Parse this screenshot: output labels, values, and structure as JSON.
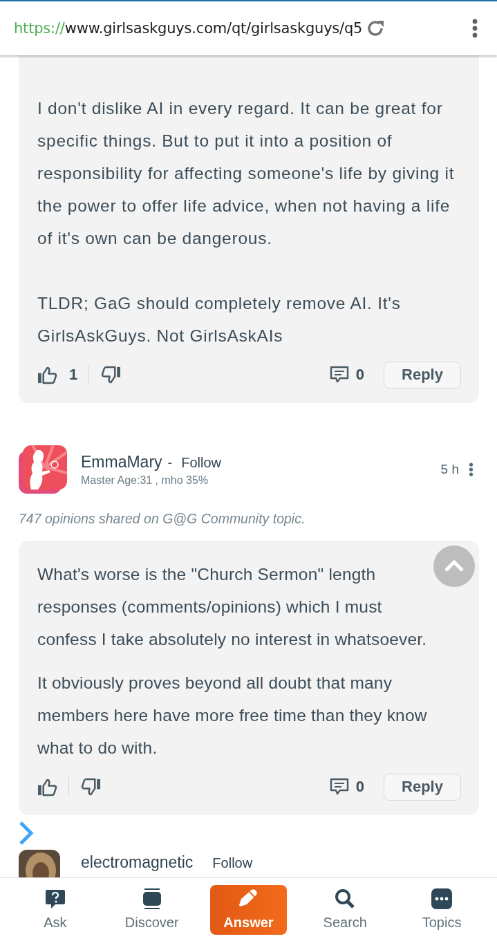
{
  "browser": {
    "url_scheme": "https://",
    "url_rest": "www.girlsaskguys.com/qt/girlsaskguys/q5"
  },
  "opinions": [
    {
      "paragraphs": [
        "I don't dislike AI in every regard. It can be great for specific things. But to put it into a position of responsibility for affecting someone's life by giving it the power to offer life advice, when not having a life of it's own can be dangerous.",
        "TLDR; GaG should completely remove AI. It's GirlsAskGuys. Not GirlsAskAIs"
      ],
      "like_count": "1",
      "comment_count": "0",
      "reply_label": "Reply"
    },
    {
      "author": {
        "name": "EmmaMary",
        "separator": "-",
        "follow": "Follow",
        "meta": "Master Age:31 , mho 35%",
        "time": "5 h"
      },
      "summary": "747 opinions shared on G@G Community topic.",
      "paragraphs": [
        "What's worse is the \"Church Sermon\" length responses (comments/opinions) which I must confess I take absolutely no interest in whatsoever.",
        "It obviously proves beyond all doubt that many members here have more free time than they know what to do with."
      ],
      "comment_count": "0",
      "reply_label": "Reply"
    }
  ],
  "next_author": {
    "name": "electromagnetic",
    "follow": "Follow"
  },
  "bottom_nav": [
    {
      "kind": "ask",
      "label": "Ask",
      "selected": false
    },
    {
      "kind": "discover",
      "label": "Discover",
      "selected": false
    },
    {
      "kind": "answer",
      "label": "Answer",
      "selected": true
    },
    {
      "kind": "search",
      "label": "Search",
      "selected": false
    },
    {
      "kind": "topics",
      "label": "Topics",
      "selected": false
    }
  ]
}
